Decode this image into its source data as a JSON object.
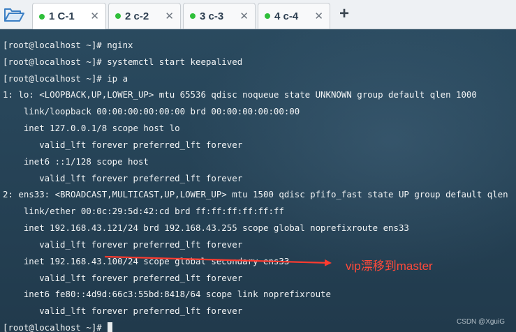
{
  "tabs": [
    {
      "label": "1 C-1",
      "active": true
    },
    {
      "label": "2 c-2",
      "active": false
    },
    {
      "label": "3 c-3",
      "active": false
    },
    {
      "label": "4 c-4",
      "active": false
    }
  ],
  "tab_close_glyph": "✕",
  "add_tab_glyph": "+",
  "colors": {
    "terminal_background": "#274154",
    "terminal_text": "#f2f4f5",
    "tab_status_dot": "#2fbf3a",
    "annotation": "#ff4a3a"
  },
  "icons": {
    "open_session": "folder-icon",
    "tab_status": "dot-icon",
    "tab_close": "close-icon",
    "new_tab": "plus-icon",
    "annotation": "arrow-icon"
  },
  "terminal": {
    "lines": [
      "[root@localhost ~]# nginx",
      "[root@localhost ~]# systemctl start keepalived",
      "[root@localhost ~]# ip a",
      "1: lo: <LOOPBACK,UP,LOWER_UP> mtu 65536 qdisc noqueue state UNKNOWN group default qlen 1000",
      "    link/loopback 00:00:00:00:00:00 brd 00:00:00:00:00:00",
      "    inet 127.0.0.1/8 scope host lo",
      "       valid_lft forever preferred_lft forever",
      "    inet6 ::1/128 scope host",
      "       valid_lft forever preferred_lft forever",
      "2: ens33: <BROADCAST,MULTICAST,UP,LOWER_UP> mtu 1500 qdisc pfifo_fast state UP group default qlen",
      "    link/ether 00:0c:29:5d:42:cd brd ff:ff:ff:ff:ff:ff",
      "    inet 192.168.43.121/24 brd 192.168.43.255 scope global noprefixroute ens33",
      "       valid_lft forever preferred_lft forever",
      "    inet 192.168.43.100/24 scope global secondary ens33",
      "       valid_lft forever preferred_lft forever",
      "    inet6 fe80::4d9d:66c3:55bd:8418/64 scope link noprefixroute",
      "       valid_lft forever preferred_lft forever",
      "[root@localhost ~]# "
    ]
  },
  "annotation": {
    "text": "vip漂移到master"
  },
  "watermark": "CSDN @XguiG"
}
